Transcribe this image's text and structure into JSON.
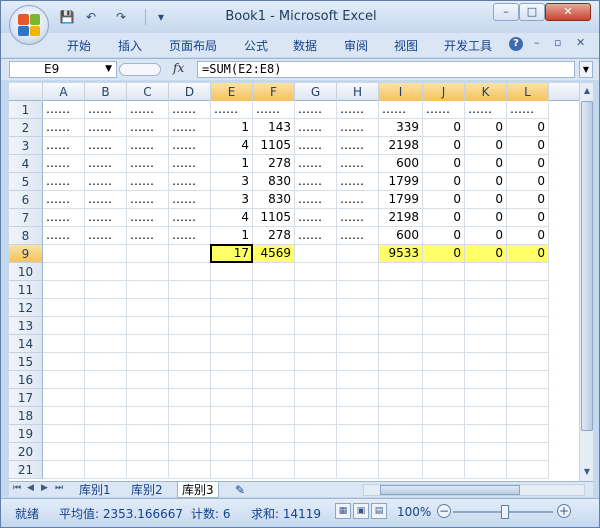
{
  "window": {
    "title": "Book1 - Microsoft Excel",
    "min_label": "–",
    "max_label": "□",
    "close_label": "✕"
  },
  "quick_access": {
    "save": "💾",
    "undo": "↶",
    "redo": "↷",
    "more": "▾"
  },
  "ribbon": {
    "tabs": [
      "开始",
      "插入",
      "页面布局",
      "公式",
      "数据",
      "审阅",
      "视图",
      "开发工具"
    ],
    "help": "?",
    "min_ctl": "–",
    "restore_ctl": "▫",
    "close_ctl": "✕"
  },
  "formula_bar": {
    "name_box": "E9",
    "fx": "fx",
    "formula": "=SUM(E2:E8)",
    "expand": "▼"
  },
  "sheet": {
    "columns": [
      "A",
      "B",
      "C",
      "D",
      "E",
      "F",
      "G",
      "H",
      "I",
      "J",
      "K",
      "L"
    ],
    "rows": [
      "1",
      "2",
      "3",
      "4",
      "5",
      "6",
      "7",
      "8",
      "9",
      "10",
      "11",
      "12",
      "13",
      "14",
      "15",
      "16",
      "17",
      "18",
      "19",
      "20",
      "21"
    ],
    "cells": [
      [
        "……",
        "……",
        "……",
        "……",
        "……",
        "……",
        "……",
        "……",
        "……",
        "……",
        "……",
        "……"
      ],
      [
        "……",
        "……",
        "……",
        "……",
        "1",
        "143",
        "……",
        "……",
        "339",
        "0",
        "0",
        "0"
      ],
      [
        "……",
        "……",
        "……",
        "……",
        "4",
        "1105",
        "……",
        "……",
        "2198",
        "0",
        "0",
        "0"
      ],
      [
        "……",
        "……",
        "……",
        "……",
        "1",
        "278",
        "……",
        "……",
        "600",
        "0",
        "0",
        "0"
      ],
      [
        "……",
        "……",
        "……",
        "……",
        "3",
        "830",
        "……",
        "……",
        "1799",
        "0",
        "0",
        "0"
      ],
      [
        "……",
        "……",
        "……",
        "……",
        "3",
        "830",
        "……",
        "……",
        "1799",
        "0",
        "0",
        "0"
      ],
      [
        "……",
        "……",
        "……",
        "……",
        "4",
        "1105",
        "……",
        "……",
        "2198",
        "0",
        "0",
        "0"
      ],
      [
        "……",
        "……",
        "……",
        "……",
        "1",
        "278",
        "……",
        "……",
        "600",
        "0",
        "0",
        "0"
      ],
      [
        "",
        "",
        "",
        "",
        "17",
        "4569",
        "",
        "",
        "9533",
        "0",
        "0",
        "0"
      ]
    ],
    "highlight_color": "#ffff66",
    "selected_cell": "E9"
  },
  "sheet_tabs": {
    "nav": [
      "⏮",
      "◀",
      "▶",
      "⏭"
    ],
    "tabs": [
      "库别1",
      "库别2",
      "库别3"
    ],
    "active": "库别3",
    "insert_icon": "✎"
  },
  "status_bar": {
    "mode": "就绪",
    "average": "平均值: 2353.166667",
    "count": "计数: 6",
    "sum": "求和: 14119",
    "zoom": "100%",
    "zoom_minus": "−",
    "zoom_plus": "+"
  },
  "colors": {
    "accent": "#15428b",
    "selection": "#f5c25e"
  }
}
